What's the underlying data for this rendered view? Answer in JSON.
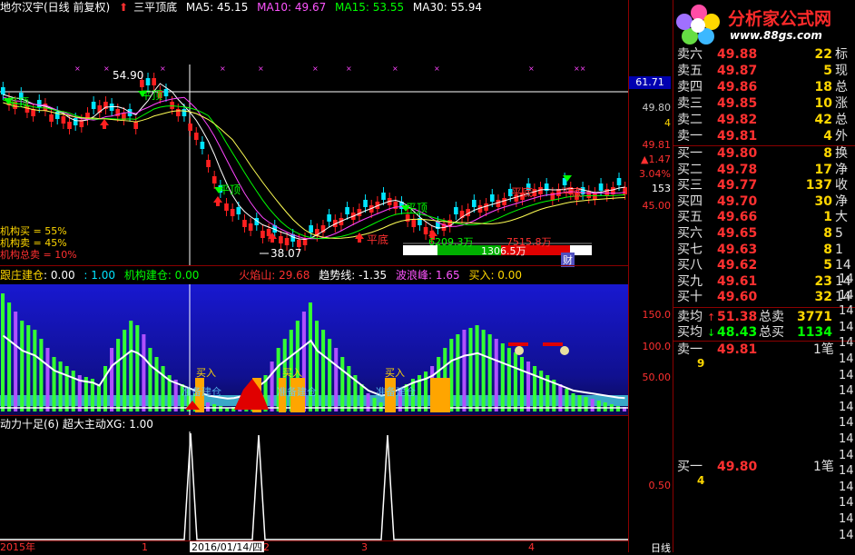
{
  "header": {
    "stock": "地尔汉宇(日线 前复权)",
    "pattern": "三平顶底",
    "ma5": "MA5: 45.15",
    "ma10": "MA10: 49.67",
    "ma15": "MA15: 53.55",
    "ma30": "MA30: 55.94"
  },
  "main_labels": {
    "high_price": "54.90",
    "low_price": "38.07",
    "ping_ding_1": "平顶",
    "ping_ding_2": "平顶",
    "ping_ding_3": "平顶",
    "ping_ding_4": "平顶",
    "ping_di_1": "平底",
    "ping_di_2": "平底",
    "ping_di_3": "平底",
    "inst_buy": "机构买 = 55%",
    "inst_sell": "机构卖 = 45%",
    "inst_total_sell": "机构总卖 = 10%",
    "bar_left": "6209.3万",
    "bar_right": "7515.8万",
    "bar_mid": "1306.5万",
    "cai": "财",
    "crosshair_price": "61.71"
  },
  "axis_main": {
    "a1": "49.80",
    "a2": "4",
    "a3": "49.81",
    "a4": "▲1.47",
    "a5": "3.04%",
    "a6": "153",
    "a7": "45.00"
  },
  "indicator2": {
    "t1": "跟庄建仓",
    "t1v": ": 0.00",
    "t2v": ": 1.00",
    "t3": "机构建仓: 0.00",
    "t4": "火焰山: 29.68",
    "t5": "趋势线: -1.35",
    "t6": "波浪峰: 1.65",
    "t7": "买入: 0.00",
    "buy1": "买入",
    "buy2": "买入",
    "buy3": "买入",
    "zhun1": "准备建仓",
    "zhun2": "准备建仓",
    "zhun3": "准备建仓",
    "axis": [
      "150.0",
      "100.0",
      "50.00"
    ]
  },
  "indicator3": {
    "title": "动力十足(6) 超大主动XG: 1.00",
    "axis": "0.50"
  },
  "dates": {
    "d1": "2015年",
    "d2": "1",
    "d3": "2016/01/14/四",
    "d4": "2",
    "d5": "3",
    "d6": "4",
    "period": "日线"
  },
  "logo": {
    "text": "分析家公式网",
    "url": "www.88gs.com"
  },
  "sell_rows": [
    {
      "label": "卖六",
      "price": "49.88",
      "vol": "22",
      "ex": "标"
    },
    {
      "label": "卖五",
      "price": "49.87",
      "vol": "5",
      "ex": "现"
    },
    {
      "label": "卖四",
      "price": "49.86",
      "vol": "18",
      "ex": "总"
    },
    {
      "label": "卖三",
      "price": "49.85",
      "vol": "10",
      "ex": "涨"
    },
    {
      "label": "卖二",
      "price": "49.82",
      "vol": "42",
      "ex": "总"
    },
    {
      "label": "卖一",
      "price": "49.81",
      "vol": "4",
      "ex": "外"
    }
  ],
  "buy_rows": [
    {
      "label": "买一",
      "price": "49.80",
      "vol": "8",
      "ex": "换"
    },
    {
      "label": "买二",
      "price": "49.78",
      "vol": "17",
      "ex": "净"
    },
    {
      "label": "买三",
      "price": "49.77",
      "vol": "137",
      "ex": "收"
    },
    {
      "label": "买四",
      "price": "49.70",
      "vol": "30",
      "ex": "净"
    },
    {
      "label": "买五",
      "price": "49.66",
      "vol": "1",
      "ex": "大"
    },
    {
      "label": "买六",
      "price": "49.65",
      "vol": "8",
      "ex": "5"
    },
    {
      "label": "买七",
      "price": "49.63",
      "vol": "8",
      "ex": "1"
    },
    {
      "label": "买八",
      "price": "49.62",
      "vol": "5",
      "ex": "14"
    },
    {
      "label": "买九",
      "price": "49.61",
      "vol": "23",
      "ex": "14"
    },
    {
      "label": "买十",
      "price": "49.60",
      "vol": "32",
      "ex": "14"
    }
  ],
  "avg": {
    "sell_label": "卖均",
    "sell_price": "51.38",
    "sell_tot_label": "总卖",
    "sell_tot": "3771",
    "buy_label": "买均",
    "buy_price": "48.43",
    "buy_tot_label": "总买",
    "buy_tot": "1134"
  },
  "ticks": {
    "sell1_label": "卖一",
    "sell1_price": "49.81",
    "sell1_n": "1笔",
    "sell1_vol": "9",
    "buy1_label": "买一",
    "buy1_price": "49.80",
    "buy1_n": "1笔",
    "buy1_vol": "4"
  },
  "time_col": [
    "14",
    "14",
    "14",
    "14",
    "14",
    "14",
    "14",
    "14",
    "14",
    "14",
    "14",
    "14",
    "14",
    "14",
    "14",
    "14",
    "14"
  ],
  "colors": {
    "up": "#ff2020",
    "down": "#00e5ff",
    "bg": "#000000",
    "frame": "#8b0000",
    "yellow": "#ffd700"
  }
}
